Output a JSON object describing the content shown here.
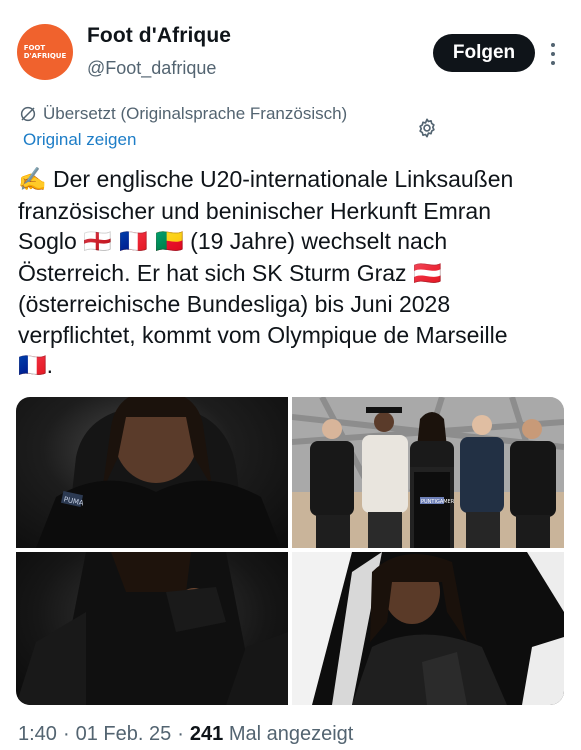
{
  "author": {
    "avatar_text_line1": "FOOT",
    "avatar_text_line2": "D'AFRIQUE",
    "display_name": "Foot d'Afrique",
    "handle": "@Foot_dafrique",
    "brand_color": "#f0622d"
  },
  "actions": {
    "follow_label": "Folgen"
  },
  "translation": {
    "status": "Übersetzt (Originalsprache Französisch)",
    "show_original": "Original zeigen"
  },
  "tweet": {
    "emoji_writing": "✍️",
    "part1": " Der englische U20-internationale Linksaußen französischer und beninischer Herkunft Emran Soglo ",
    "flags_after_name": "🏴󠁧󠁢󠁥󠁮󠁧󠁿 🇫🇷 🇧🇯",
    "part2": " (19 Jahre) wechselt nach Österreich. Er hat sich SK Sturm Graz ",
    "flag_austria": "🇦🇹",
    "part3": " (österreichische Bundesliga) bis Juni 2028 verpflichtet, kommt vom Olympique de Marseille ",
    "flag_france": "🇫🇷",
    "part4": "."
  },
  "media": {
    "jacket_patch_text": "PUMA",
    "jersey_sponsor_text": "PUNTIGAMER"
  },
  "meta": {
    "time": "1:40",
    "sep1": "·",
    "date": "01 Feb. 25",
    "sep2": "·",
    "views_count": "241",
    "views_label": "Mal angezeigt"
  },
  "colors": {
    "text_primary": "#0f1419",
    "text_secondary": "#536471",
    "link": "#1d7dc7"
  }
}
